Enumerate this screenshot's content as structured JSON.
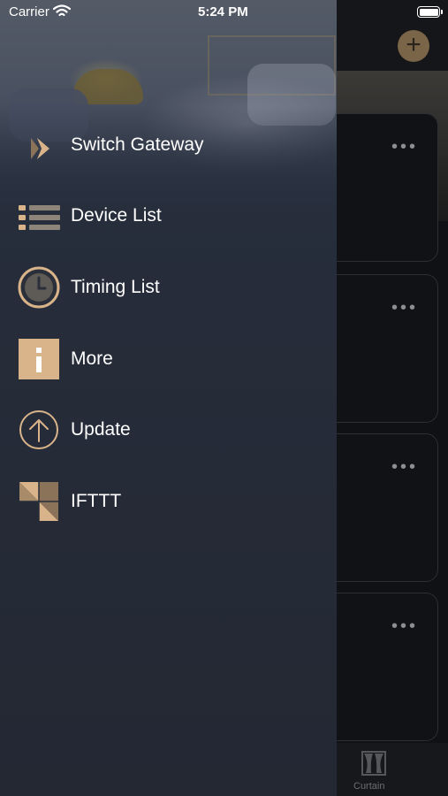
{
  "status_bar": {
    "carrier": "Carrier",
    "time": "5:24 PM"
  },
  "menu": [
    {
      "label": "Switch Gateway",
      "icon": "switch-gateway-icon"
    },
    {
      "label": "Device List",
      "icon": "list-icon"
    },
    {
      "label": "Timing List",
      "icon": "clock-icon"
    },
    {
      "label": "More",
      "icon": "info-icon"
    },
    {
      "label": "Update",
      "icon": "arrow-up-circle-icon"
    },
    {
      "label": "IFTTT",
      "icon": "ifttt-icon"
    }
  ],
  "background": {
    "add_icon": "+",
    "card_menu": "•••",
    "tab_label": "Curtain"
  },
  "colors": {
    "accent": "#d9b48a",
    "drawer": "#262c39",
    "background": "#101115"
  }
}
